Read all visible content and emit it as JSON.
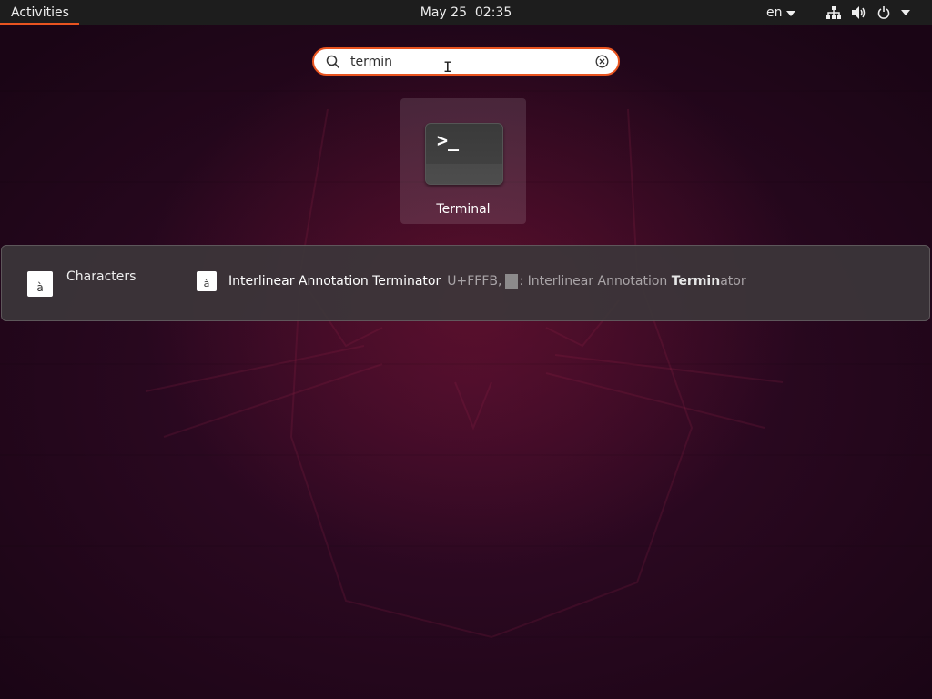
{
  "topbar": {
    "activities": "Activities",
    "clock": "May 25  02:35",
    "language": "en",
    "icons": [
      "network-icon",
      "volume-icon",
      "power-icon",
      "chevron-down-icon"
    ]
  },
  "search": {
    "value": "termin",
    "placeholder": ""
  },
  "apps": [
    {
      "label": "Terminal",
      "icon": "terminal-icon",
      "prompt": ">_"
    }
  ],
  "providers": [
    {
      "name": "Characters",
      "icon_glyph": "à",
      "results": [
        {
          "icon_glyph": "à",
          "title": "Interlinear Annotation Terminator",
          "desc_prefix": "U+FFFB,",
          "desc_after_glyph": ": Interlinear Annotation ",
          "desc_match": "Termin",
          "desc_suffix": "ator"
        }
      ]
    }
  ],
  "colors": {
    "accent": "#e95420",
    "topbar_bg": "#1d1d1d",
    "panel_bg": "#3c363a"
  }
}
